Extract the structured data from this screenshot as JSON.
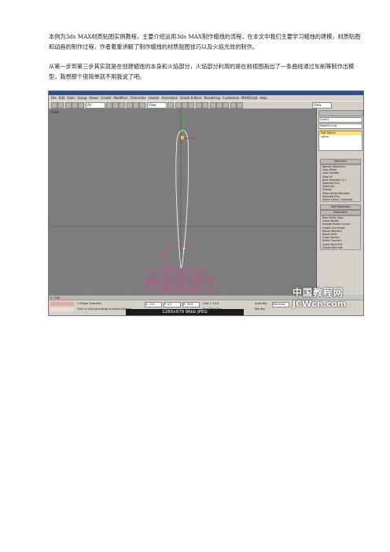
{
  "paragraphs": [
    "本例为3ds MAX材质贴图实例教程，主要介绍运用3ds MAX制作蜡烛的流程，在本文中我们主要学习蜡烛的建模，材质贴图和动画的制作过程，作者着重讲解了制作蜡烛的材质贴图技巧以及火焰光效的制作。",
    "从第一步到第三步其实就是在创建蜡烛的本身和火焰部分，火焰部分利用的是在前视图画出了一条曲线通过车削等制作出模型，我想那个很简单就不用我说了吧。"
  ],
  "screenshot": {
    "menu_items": [
      "File",
      "Edit",
      "Tools",
      "Group",
      "Views",
      "Create",
      "Modifiers",
      "Character",
      "reactor",
      "Animation",
      "Graph Editors",
      "Rendering",
      "Customize",
      "MAXScript",
      "Help"
    ],
    "toolbar_dropdowns": [
      "All",
      "View",
      "View"
    ],
    "viewport_label": "Front",
    "command_panel": {
      "object_field": "Line01",
      "modifier_list": "Modifier List",
      "stack": [
        "Edit Spline",
        "Lathe"
      ],
      "rollouts": [
        "Selection",
        "Soft Selection",
        "Geometry"
      ],
      "selection_lines": [
        "Named Selections:",
        "Copy   Paste",
        "Lock Handles",
        "Alike   All",
        "Area Selection: 0.1",
        "Segment End",
        "Select By...",
        "Display",
        "Show Vertex Numbers",
        "Selected Only",
        "Spline 1/Vert 1 Selected"
      ],
      "geometry_lines": [
        "New Vertex Type",
        "Linear   Bezier",
        "Smooth   Bezier Corner",
        "Create Line   Break",
        "Attach   Reorient",
        "Attach Mult.",
        "Cross Section",
        "Refine   Connect",
        "Linear   Bind first",
        "Closed   Bind last"
      ]
    },
    "trackbar_text": "0 / 100",
    "status": {
      "selected": "1 Shape Selected",
      "prompt": "Click or click-and-drag to select objects",
      "x": "X: -2.8",
      "y": "Y: 0.0",
      "z": "Z: 30.8",
      "grid": "Grid = 10.0",
      "autokey": "Auto Key",
      "setkey": "Set Key",
      "key_filter": "Selected",
      "time_tag": "Add Time Tag"
    }
  },
  "caption": "1280x979  96kb  JPEG",
  "watermark": {
    "line1": "中国教程网",
    "line2": "JCWcn.com"
  },
  "colors": {
    "viewport_bg": "#7d7d7d",
    "spline": "#ffffff",
    "lathe_mesh": "#e0409a",
    "selected_stack": "#ffe36b"
  }
}
